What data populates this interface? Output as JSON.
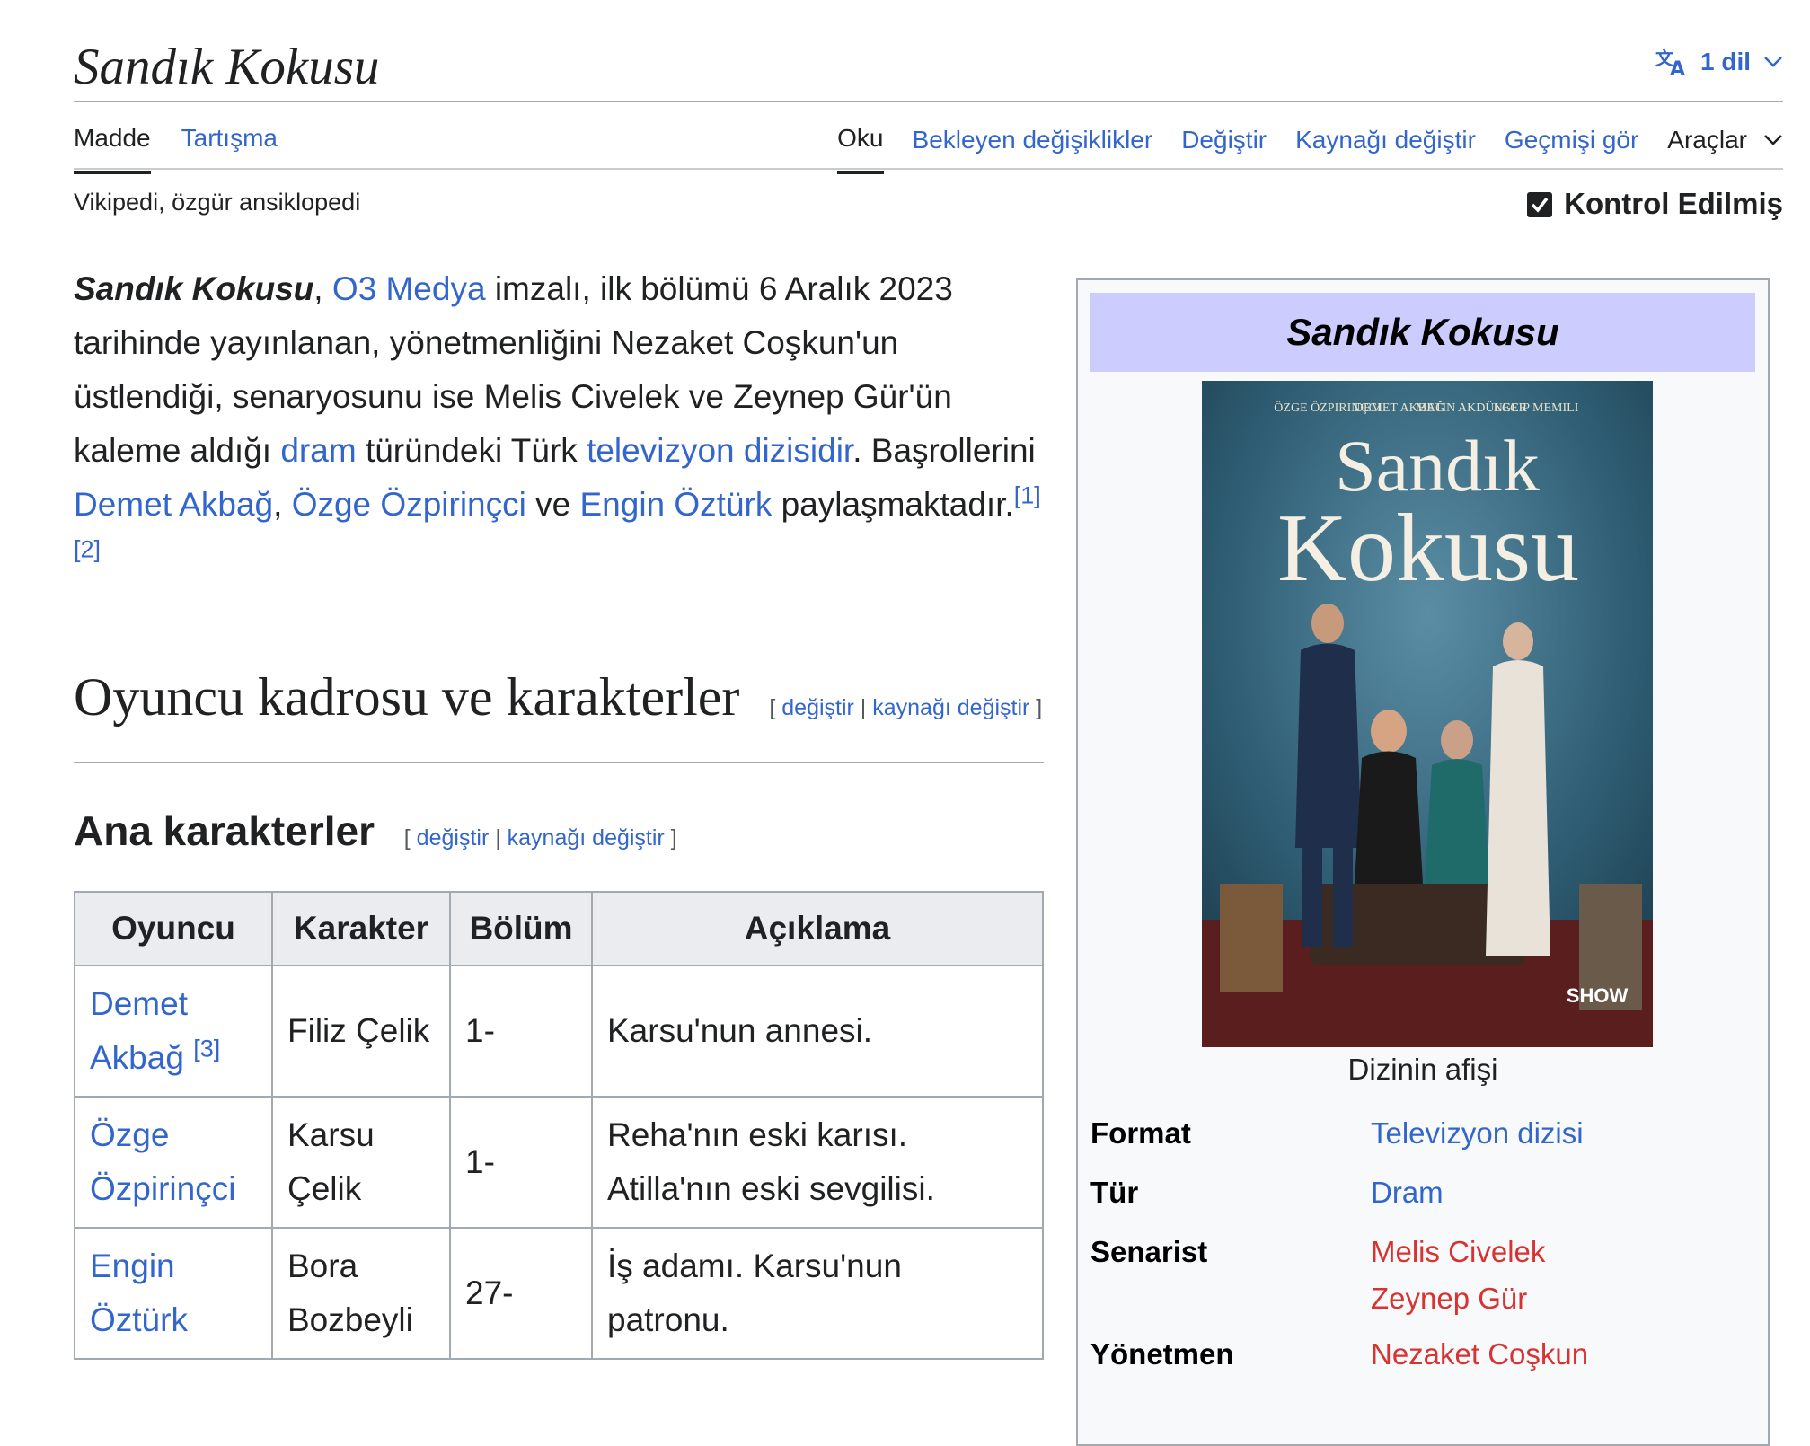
{
  "header": {
    "title": "Sandık Kokusu",
    "lang_count": "1 dil"
  },
  "tabs": {
    "left": [
      "Madde",
      "Tartışma"
    ],
    "right": [
      "Oku",
      "Bekleyen değişiklikler",
      "Değiştir",
      "Kaynağı değiştir",
      "Geçmişi gör"
    ],
    "tools": "Araçlar"
  },
  "tagline": "Vikipedi, özgür ansiklopedi",
  "reviewed": "Kontrol Edilmiş",
  "lead": {
    "name": "Sandık Kokusu",
    "comma": ",",
    "link_o3": "O3 Medya",
    "t1": " imzalı, ilk bölümü 6 Aralık 2023 tarihinde yayınlanan, yönetmenliğini Nezaket Coşkun'un üstlendiği, senaryosunu ise Melis Civelek ve Zeynep Gür'ün kaleme aldığı ",
    "link_dram": "dram",
    "t2": " türündeki Türk ",
    "link_tv": "televizyon dizisidir",
    "t3": ". Başrollerini ",
    "link_demet": "Demet Akbağ",
    "t4": ", ",
    "link_ozge": "Özge Özpirinçci",
    "t5": " ve ",
    "link_engin": "Engin Öztürk",
    "t6": " paylaşmaktadır.",
    "ref1": "[1]",
    "ref2": "[2]"
  },
  "section_cast": {
    "heading": "Oyuncu kadrosu ve karakterler",
    "edit": "değiştir",
    "edit_source": "kaynağı değiştir"
  },
  "section_main": {
    "heading": "Ana karakterler",
    "edit": "değiştir",
    "edit_source": "kaynağı değiştir"
  },
  "cast_table": {
    "headers": [
      "Oyuncu",
      "Karakter",
      "Bölüm",
      "Açıklama"
    ],
    "rows": [
      {
        "actor": "Demet Akbağ",
        "ref": "[3]",
        "character": "Filiz Çelik",
        "episodes": "1-",
        "description": "Karsu'nun annesi."
      },
      {
        "actor": "Özge Özpirinçci",
        "ref": "",
        "character": "Karsu Çelik",
        "episodes": "1-",
        "description": "Reha'nın eski karısı. Atilla'nın eski sevgilisi."
      },
      {
        "actor": "Engin Öztürk",
        "ref": "",
        "character": "Bora Bozbeyli",
        "episodes": "27-",
        "description": "İş adamı. Karsu'nun patronu."
      }
    ]
  },
  "infobox": {
    "title": "Sandık Kokusu",
    "poster": {
      "cast_names": [
        "ÖZGE ÖZPIRINÇCI",
        "DEMET AKBAĞ",
        "METIN AKDÜLGER",
        "NECIP MEMILI"
      ],
      "line1": "Sandık",
      "line2": "Kokusu",
      "channel": "SHOW"
    },
    "caption": "Dizinin afişi",
    "rows": [
      {
        "label": "Format",
        "value": "Televizyon dizisi"
      },
      {
        "label": "Tür",
        "value": "Dram"
      },
      {
        "label": "Senarist",
        "value": "Melis Civelek",
        "value2": "Zeynep Gür"
      },
      {
        "label": "Yönetmen",
        "value": "Nezaket Coşkun"
      }
    ]
  },
  "colors": {
    "link": "#3366cc",
    "redlink": "#d73333",
    "infobox_title_bg": "#ccccff",
    "table_header_bg": "#eaecf0"
  }
}
